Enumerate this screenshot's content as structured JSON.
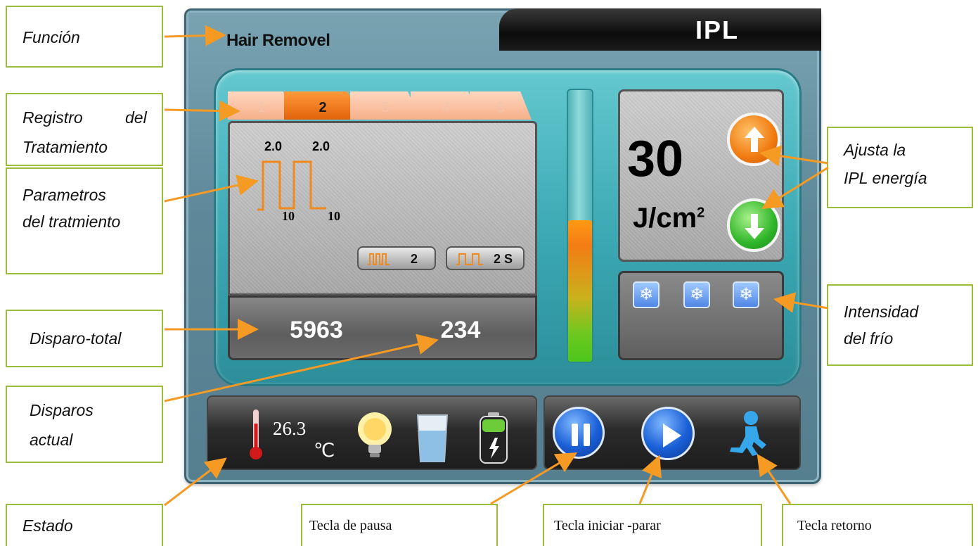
{
  "screen": {
    "function_title": "Hair Removel",
    "mode_label": "IPL",
    "record_tabs": [
      "1",
      "2",
      "3",
      "4",
      "5"
    ],
    "active_tab_index": 1,
    "pulse": {
      "width_labels": [
        "2.0",
        "2.0"
      ],
      "delay_labels": [
        "10",
        "10"
      ]
    },
    "pulse_count_button": "2",
    "interval_button": "2 S",
    "total_shots": "5963",
    "current_shots": "234",
    "energy_value": "30",
    "energy_unit": "J/cm",
    "energy_unit_sup": "2",
    "energy_bar_level": 0.52,
    "cooling_levels": 3,
    "temperature": "26.3",
    "temperature_unit": "℃"
  },
  "annotations": {
    "funcion": "Función",
    "registro": "Registro del Tratamiento",
    "registro_l1a": "Registro",
    "registro_l1b": "del",
    "registro_l2": "Tratamiento",
    "parametros_l1": "Parametros",
    "parametros_l2": "del tratmiento",
    "disparo_total": "Disparo-total",
    "disparos_actual_l1": "Disparos",
    "disparos_actual_l2": "actual",
    "estado": "Estado",
    "ajusta_l1": "Ajusta la",
    "ajusta_l2": "IPL energía",
    "intensidad_l1": "Intensidad",
    "intensidad_l2": "del frío",
    "tecla_pausa": "Tecla de pausa",
    "tecla_iniciar": "Tecla iniciar -parar",
    "tecla_retorno": "Tecla retorno"
  },
  "colors": {
    "callout_border": "#9bbb3a",
    "arrow": "#f59a23",
    "panel_teal": "#3aa7b2",
    "tab_active": "#e2620a",
    "energy_up": "#f07a10",
    "energy_down": "#2fb52a"
  },
  "icons": [
    "thermometer-icon",
    "bulb-icon",
    "water-tank-icon",
    "battery-icon",
    "pause-icon",
    "play-icon",
    "return-icon",
    "snowflake-icon",
    "arrow-up-icon",
    "arrow-down-icon"
  ]
}
